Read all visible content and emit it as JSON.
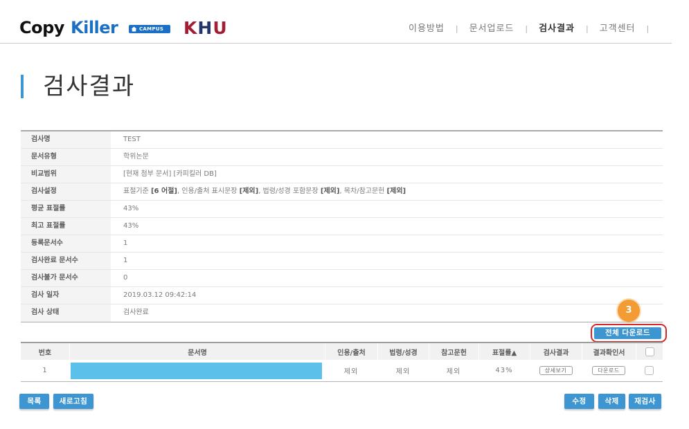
{
  "colors": {
    "accent": "#3d96d2",
    "redaction": "#5bc1ea",
    "annotation": "#f39b34",
    "highlight": "#d9262b",
    "logo_blue": "#1b6fc4",
    "khu_red": "#a31d35",
    "khu_navy": "#23356b"
  },
  "icons": {
    "campus_badge": "house-icon",
    "select": "checkbox-icon"
  },
  "header": {
    "logo": {
      "copy": "Copy",
      "killer": "Killer",
      "badge": "CAMPUS",
      "khu": [
        "K",
        "H",
        "U"
      ]
    },
    "nav": [
      {
        "label": "이용방법",
        "active": false
      },
      {
        "label": "문서업로드",
        "active": false
      },
      {
        "label": "검사결과",
        "active": true
      },
      {
        "label": "고객센터",
        "active": false
      }
    ],
    "nav_separator": "|"
  },
  "page_title": "검사결과",
  "info": {
    "rows": [
      {
        "label": "검사명",
        "value": "TEST"
      },
      {
        "label": "문서유형",
        "value": "학위논문"
      },
      {
        "label": "비교범위",
        "value": "[현재 첨부 문서] [카피킬러 DB]"
      },
      {
        "label": "검사설정",
        "segments": [
          {
            "text": "표절기준 ",
            "bold": false
          },
          {
            "text": "[6 어절]",
            "bold": true
          },
          {
            "text": ", 인용/출처 표시문장 ",
            "bold": false
          },
          {
            "text": "[제외]",
            "bold": true
          },
          {
            "text": ", 법령/성경 포함문장 ",
            "bold": false
          },
          {
            "text": "[제외]",
            "bold": true
          },
          {
            "text": ", 목차/참고문헌 ",
            "bold": false
          },
          {
            "text": "[제외]",
            "bold": true
          }
        ]
      },
      {
        "label": "평균 표절률",
        "value": "43%"
      },
      {
        "label": "최고 표절률",
        "value": "43%"
      },
      {
        "label": "등록문서수",
        "value": "1"
      },
      {
        "label": "검사완료 문서수",
        "value": "1"
      },
      {
        "label": "검사불가 문서수",
        "value": "0"
      },
      {
        "label": "검사 일자",
        "value": "2019.03.12 09:42:14"
      },
      {
        "label": "검사 상태",
        "value": "검사완료"
      }
    ]
  },
  "annotation": {
    "number": "3"
  },
  "download_all_label": "전체 다운로드",
  "results": {
    "columns": [
      "번호",
      "문서명",
      "인용/출처",
      "법령/성경",
      "참고문헌",
      "표절률▲",
      "검사결과",
      "결과확인서"
    ],
    "rows": [
      {
        "no": "1",
        "citation": "제외",
        "law": "제외",
        "reference": "제외",
        "rate": "43%",
        "detail_label": "상세보기",
        "download_label": "다운로드"
      }
    ]
  },
  "footer_buttons": {
    "list": "목록",
    "refresh": "새로고침",
    "edit": "수정",
    "delete": "삭제",
    "recheck": "재검사"
  }
}
